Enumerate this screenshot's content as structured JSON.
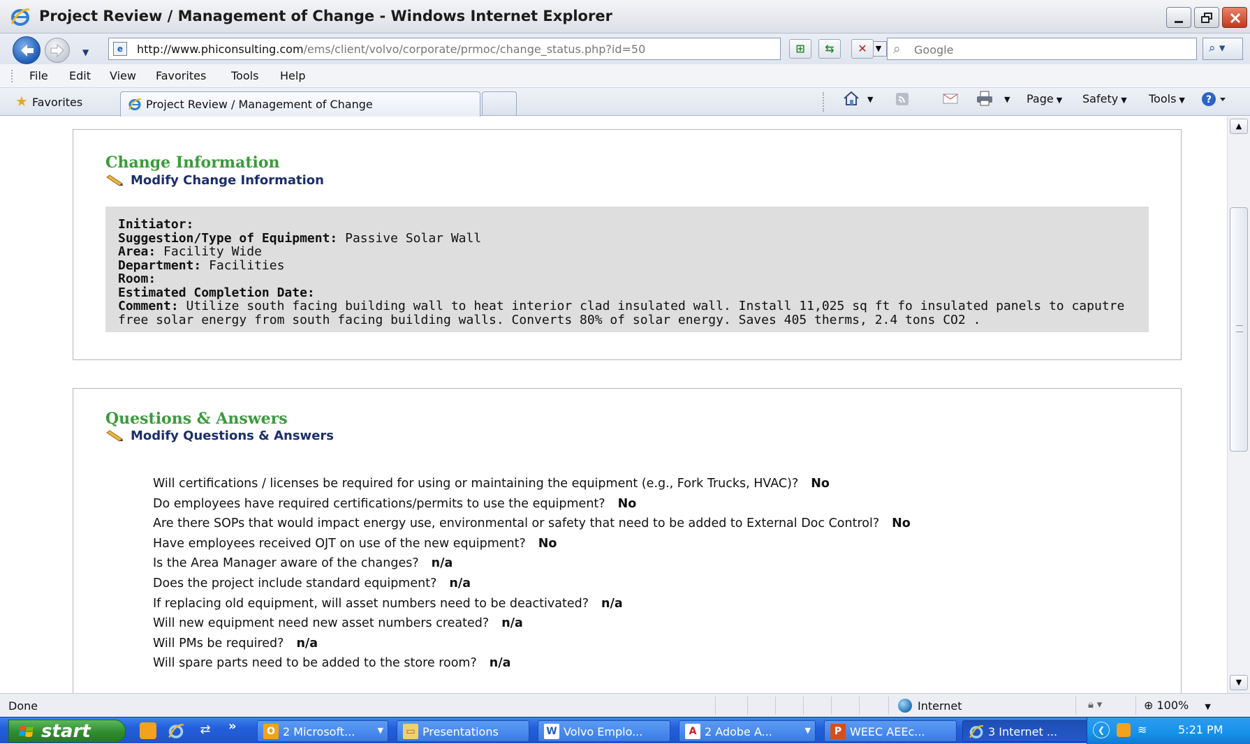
{
  "window": {
    "title": "Project Review / Management of Change - Windows Internet Explorer"
  },
  "address_bar": {
    "url_host": "http://www.phiconsulting.com",
    "url_path": "/ems/client/volvo/corporate/prmoc/change_status.php?id=50",
    "search_placeholder": "Google"
  },
  "menu": {
    "items": [
      "File",
      "Edit",
      "View",
      "Favorites",
      "Tools",
      "Help"
    ]
  },
  "tabs": {
    "favorites_label": "Favorites",
    "active_tab_label": "Project Review / Management of Change"
  },
  "command_bar": {
    "page_label": "Page",
    "safety_label": "Safety",
    "tools_label": "Tools"
  },
  "change_info": {
    "heading": "Change Information",
    "modify_link": "Modify Change Information",
    "fields": [
      {
        "key": "Initiator:",
        "value": ""
      },
      {
        "key": "Suggestion/Type of Equipment:",
        "value": "Passive Solar Wall"
      },
      {
        "key": "Area:",
        "value": "Facility Wide"
      },
      {
        "key": "Department:",
        "value": "Facilities"
      },
      {
        "key": "Room:",
        "value": ""
      },
      {
        "key": "Estimated Completion Date:",
        "value": ""
      }
    ],
    "comment_key": "Comment:",
    "comment_line1": "Utilize south facing building wall to heat interior clad insulated wall. Install 11,025 sq ft fo insulated panels to caputre",
    "comment_line2": "free solar energy from south facing building walls. Converts 80% of solar energy. Saves 405 therms, 2.4 tons CO2 ."
  },
  "qa": {
    "heading": "Questions & Answers",
    "modify_link": "Modify Questions & Answers",
    "items": [
      {
        "q": "Will certifications / licenses be required for using or maintaining the equipment (e.g., Fork Trucks, HVAC)?",
        "a": "No"
      },
      {
        "q": "Do employees have required certifications/permits to use the equipment?",
        "a": "No"
      },
      {
        "q": "Are there SOPs that would impact energy use, environmental or safety that need to be added to External Doc Control?",
        "a": "No"
      },
      {
        "q": "Have employees received OJT on use of the new equipment?",
        "a": "No"
      },
      {
        "q": "Is the Area Manager aware of the changes?",
        "a": "n/a"
      },
      {
        "q": "Does the project include standard equipment?",
        "a": "n/a"
      },
      {
        "q": "If replacing old equipment, will asset numbers need to be deactivated?",
        "a": "n/a"
      },
      {
        "q": "Will new equipment need new asset numbers created?",
        "a": "n/a"
      },
      {
        "q": "Will PMs be required?",
        "a": "n/a"
      },
      {
        "q": "Will spare parts need to be added to the store room?",
        "a": "n/a"
      }
    ]
  },
  "status_bar": {
    "status": "Done",
    "zone": "Internet",
    "zoom": "100%"
  },
  "taskbar": {
    "start_label": "start",
    "more_label": "»",
    "tasks": [
      {
        "label": "2 Microsoft...",
        "icon": "outlook-icon",
        "color": "#f3a21b"
      },
      {
        "label": "Presentations",
        "icon": "folder-icon",
        "color": "#f0d070"
      },
      {
        "label": "Volvo Emplo...",
        "icon": "word-icon",
        "color": "#2a5fbf"
      },
      {
        "label": "2 Adobe A...",
        "icon": "adobe-icon",
        "color": "#c8201e"
      },
      {
        "label": "WEEC AEEc...",
        "icon": "powerpoint-icon",
        "color": "#d2501f"
      },
      {
        "label": "3 Internet ...",
        "icon": "ie-icon",
        "color": "#3a8ee6"
      }
    ],
    "clock": "5:21 PM"
  }
}
